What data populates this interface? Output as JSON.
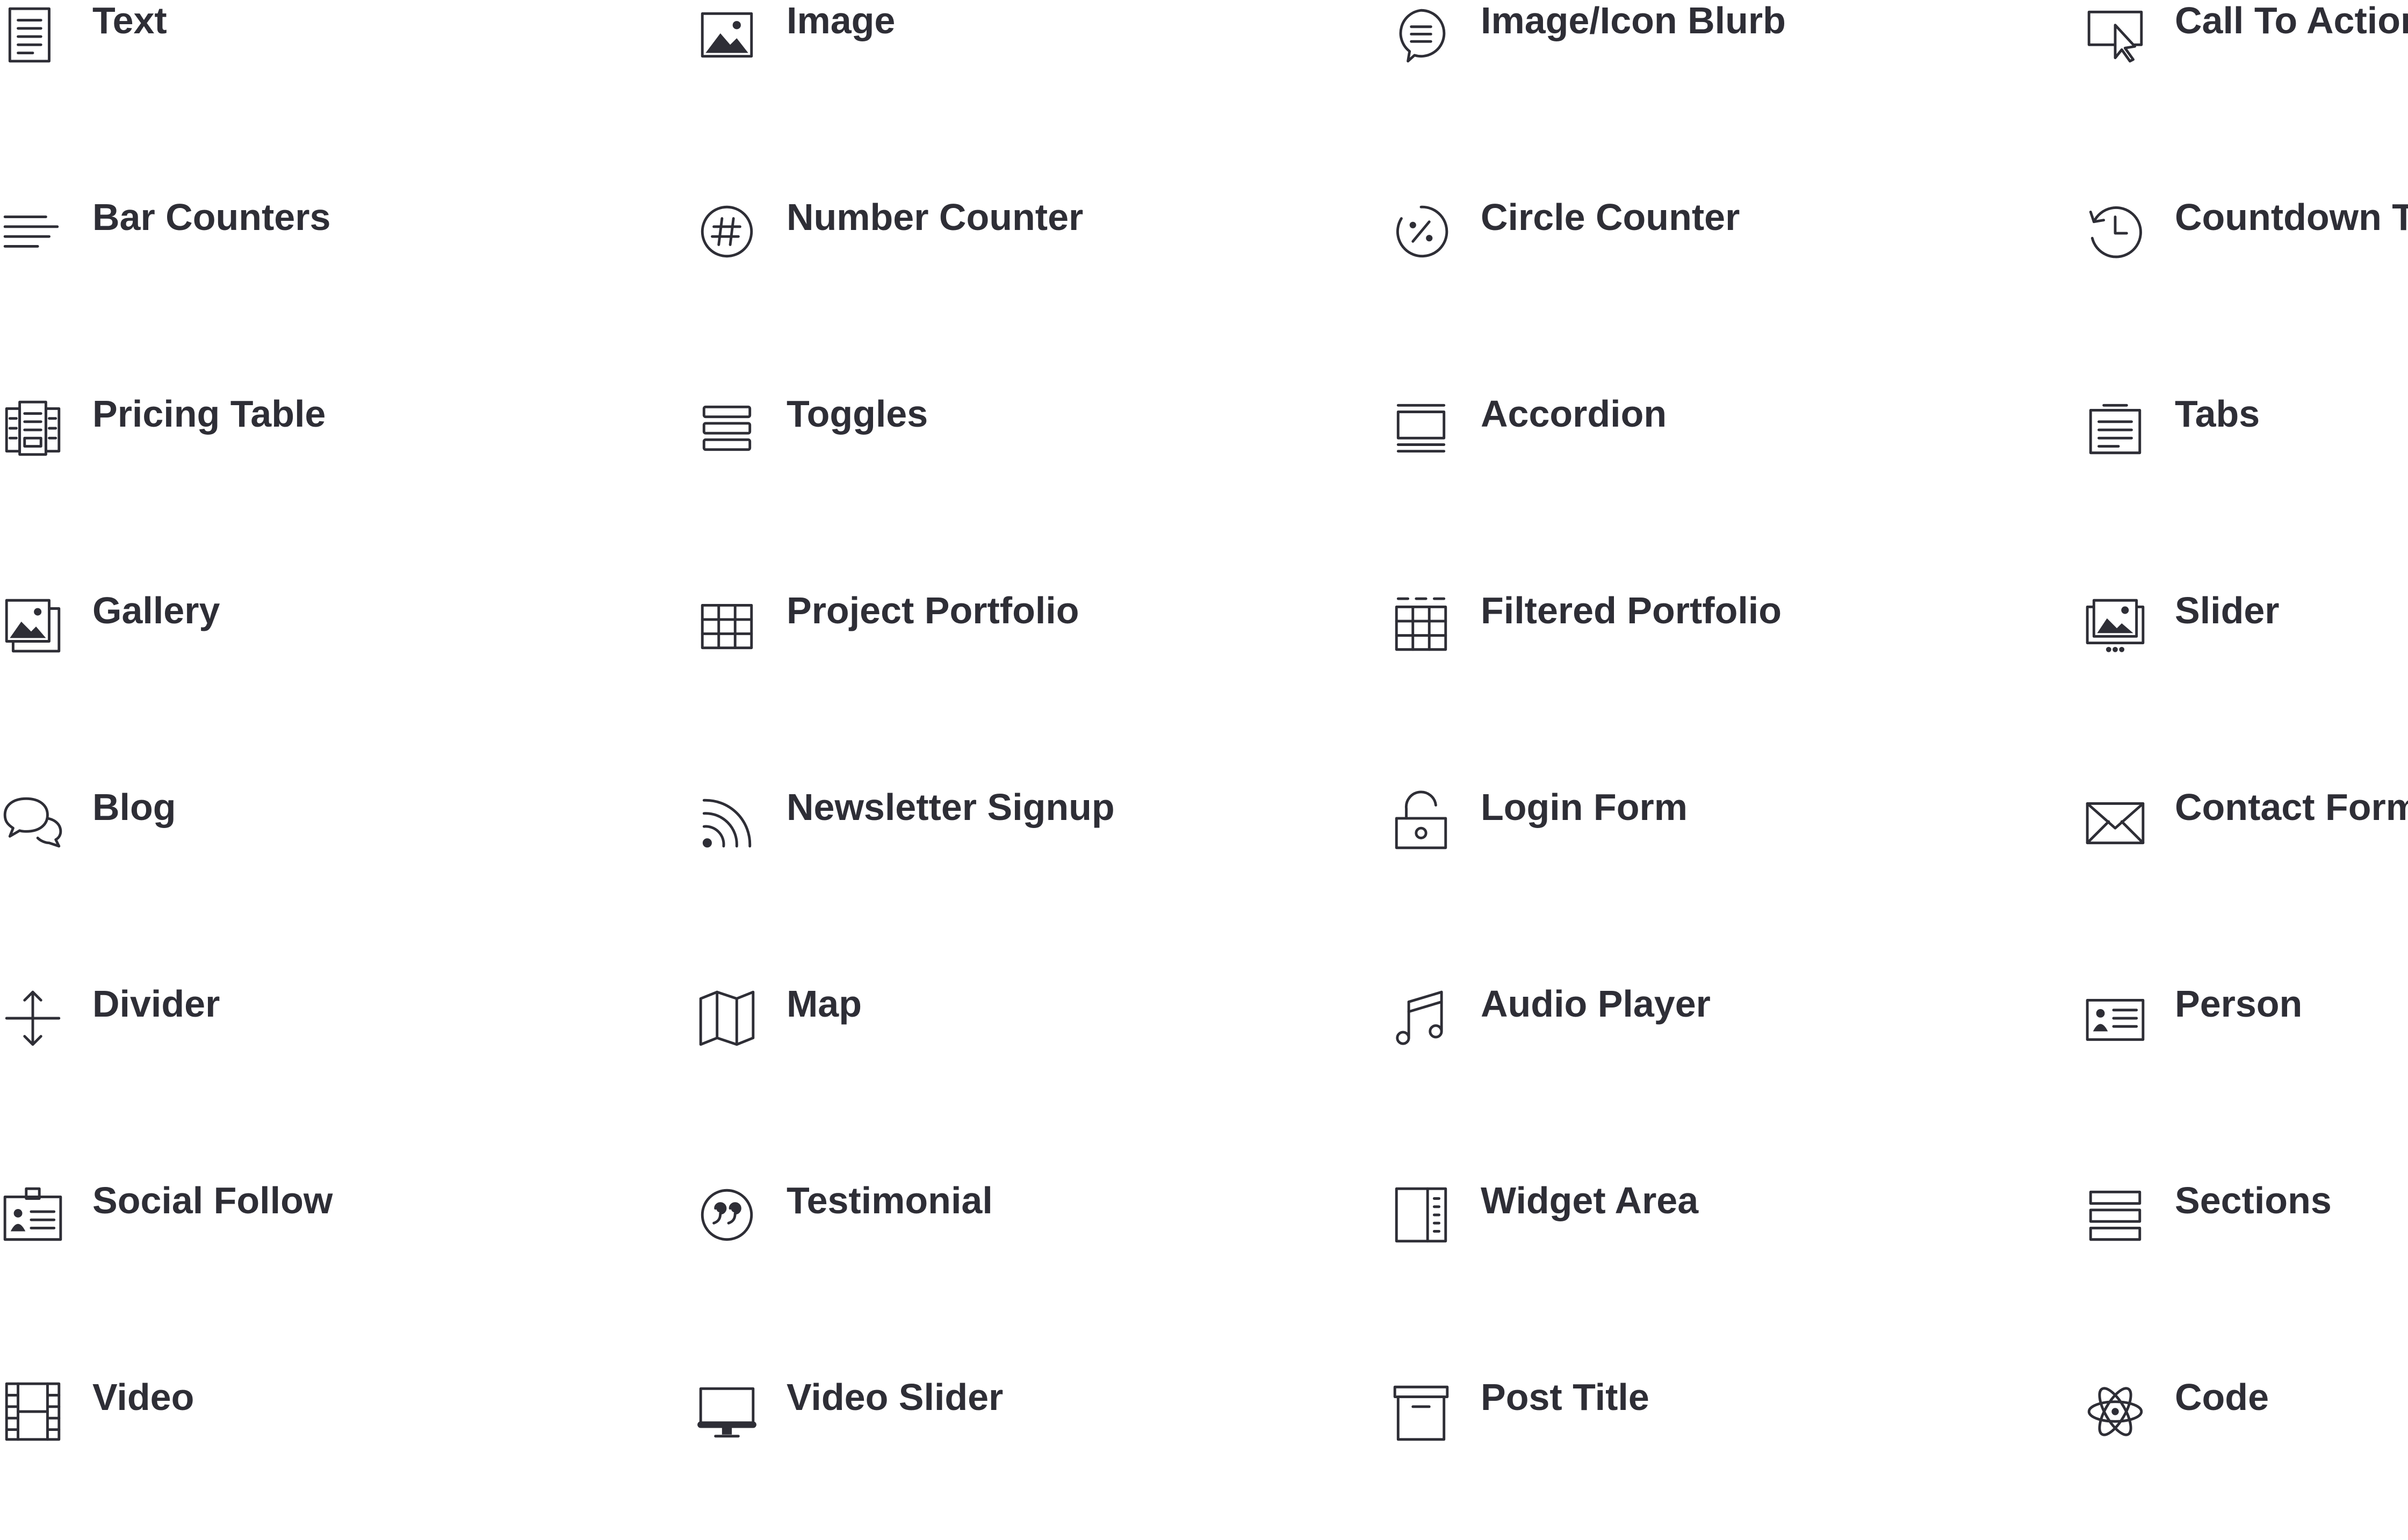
{
  "modules": [
    {
      "label": "Text",
      "icon": "text-icon"
    },
    {
      "label": "Image",
      "icon": "image-icon"
    },
    {
      "label": "Image/Icon Blurb",
      "icon": "blurb-icon"
    },
    {
      "label": "Call To Action",
      "icon": "call-to-action-icon"
    },
    {
      "label": "Bar Counters",
      "icon": "bar-counters-icon"
    },
    {
      "label": "Number Counter",
      "icon": "number-counter-icon"
    },
    {
      "label": "Circle Counter",
      "icon": "circle-counter-icon"
    },
    {
      "label": "Countdown Ti",
      "icon": "countdown-timer-icon"
    },
    {
      "label": "Pricing Table",
      "icon": "pricing-table-icon"
    },
    {
      "label": "Toggles",
      "icon": "toggles-icon"
    },
    {
      "label": "Accordion",
      "icon": "accordion-icon"
    },
    {
      "label": "Tabs",
      "icon": "tabs-icon"
    },
    {
      "label": "Gallery",
      "icon": "gallery-icon"
    },
    {
      "label": "Project Portfolio",
      "icon": "portfolio-icon"
    },
    {
      "label": "Filtered Portfolio",
      "icon": "filtered-portfolio-icon"
    },
    {
      "label": "Slider",
      "icon": "slider-icon"
    },
    {
      "label": "Blog",
      "icon": "blog-icon"
    },
    {
      "label": "Newsletter Signup",
      "icon": "newsletter-icon"
    },
    {
      "label": "Login Form",
      "icon": "login-form-icon"
    },
    {
      "label": "Contact Form",
      "icon": "contact-form-icon"
    },
    {
      "label": "Divider",
      "icon": "divider-icon"
    },
    {
      "label": "Map",
      "icon": "map-icon"
    },
    {
      "label": "Audio Player",
      "icon": "audio-player-icon"
    },
    {
      "label": "Person",
      "icon": "person-icon"
    },
    {
      "label": "Social Follow",
      "icon": "social-follow-icon"
    },
    {
      "label": "Testimonial",
      "icon": "testimonial-icon"
    },
    {
      "label": "Widget Area",
      "icon": "widget-area-icon"
    },
    {
      "label": "Sections",
      "icon": "sections-icon"
    },
    {
      "label": "Video",
      "icon": "video-icon"
    },
    {
      "label": "Video Slider",
      "icon": "video-slider-icon"
    },
    {
      "label": "Post Title",
      "icon": "post-title-icon"
    },
    {
      "label": "Code",
      "icon": "code-icon"
    }
  ]
}
